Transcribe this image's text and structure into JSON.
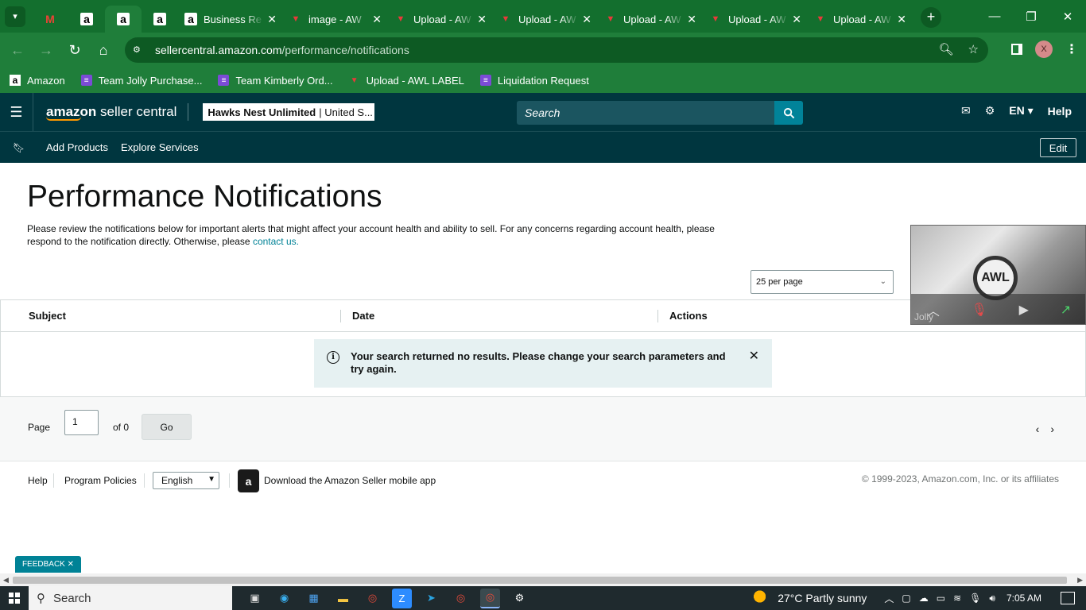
{
  "browser": {
    "tabs": [
      {
        "type": "pinned",
        "icon": "gmail-icon",
        "glyph": "M"
      },
      {
        "type": "pinned",
        "icon": "amazon-icon",
        "glyph": "a"
      },
      {
        "type": "pinned",
        "icon": "amazon-icon",
        "glyph": "a",
        "active": true
      },
      {
        "type": "pinned",
        "icon": "amazon-icon",
        "glyph": "a"
      },
      {
        "type": "normal",
        "icon": "amazon-icon",
        "glyph": "a",
        "title": "Business Re"
      },
      {
        "type": "normal",
        "icon": "awl-icon",
        "glyph": "▼",
        "title": "image - AW"
      },
      {
        "type": "normal",
        "icon": "awl-icon",
        "glyph": "▼",
        "title": "Upload - AW"
      },
      {
        "type": "normal",
        "icon": "awl-icon",
        "glyph": "▼",
        "title": "Upload - AW"
      },
      {
        "type": "normal",
        "icon": "awl-icon",
        "glyph": "▼",
        "title": "Upload - AW"
      },
      {
        "type": "normal",
        "icon": "awl-icon",
        "glyph": "▼",
        "title": "Upload - AW"
      },
      {
        "type": "normal",
        "icon": "awl-icon",
        "glyph": "▼",
        "title": "Upload - AW"
      }
    ],
    "url_host": "sellercentral.amazon.com",
    "url_path": "/performance/notifications",
    "profile_initial": "X",
    "bookmarks": [
      {
        "icon": "amazon-icon",
        "label": "Amazon"
      },
      {
        "icon": "list-icon",
        "label": "Team Jolly Purchase..."
      },
      {
        "icon": "list-icon",
        "label": "Team Kimberly Ord..."
      },
      {
        "icon": "awl-icon",
        "label": "Upload - AWL LABEL"
      },
      {
        "icon": "list-icon",
        "label": "Liquidation Request"
      }
    ]
  },
  "header": {
    "logo_bold": "amazon",
    "logo_rest": " seller central",
    "account_name": "Hawks Nest Unlimited",
    "account_region": "| United S...",
    "search_placeholder": "Search",
    "lang": "EN",
    "help": "Help"
  },
  "subnav": {
    "links": [
      "Add Products",
      "Explore Services"
    ],
    "edit": "Edit"
  },
  "main": {
    "title": "Performance Notifications",
    "intro": "Please review the notifications below for important alerts that might affect your account health and ability to sell. For any concerns regarding account health, please respond to the notification directly. Otherwise, please ",
    "contact_link": "contact us.",
    "per_page": "25 per page",
    "columns": [
      "Subject",
      "Date",
      "Actions"
    ],
    "alert": "Your search returned no results. Please change your search parameters and try again.",
    "pager": {
      "label": "Page",
      "value": "1",
      "of": "of 0",
      "go": "Go"
    }
  },
  "footer": {
    "help": "Help",
    "policies": "Program Policies",
    "language": "English",
    "app_text": "Download the Amazon Seller mobile app",
    "copyright": "© 1999-2023, Amazon.com, Inc. or its affiliates"
  },
  "feedback": "FEEDBACK",
  "video": {
    "name": "Jolly",
    "logo_text": "AWL"
  },
  "taskbar": {
    "search": "Search",
    "weather": "27°C  Partly sunny",
    "time": "7:05 AM"
  }
}
